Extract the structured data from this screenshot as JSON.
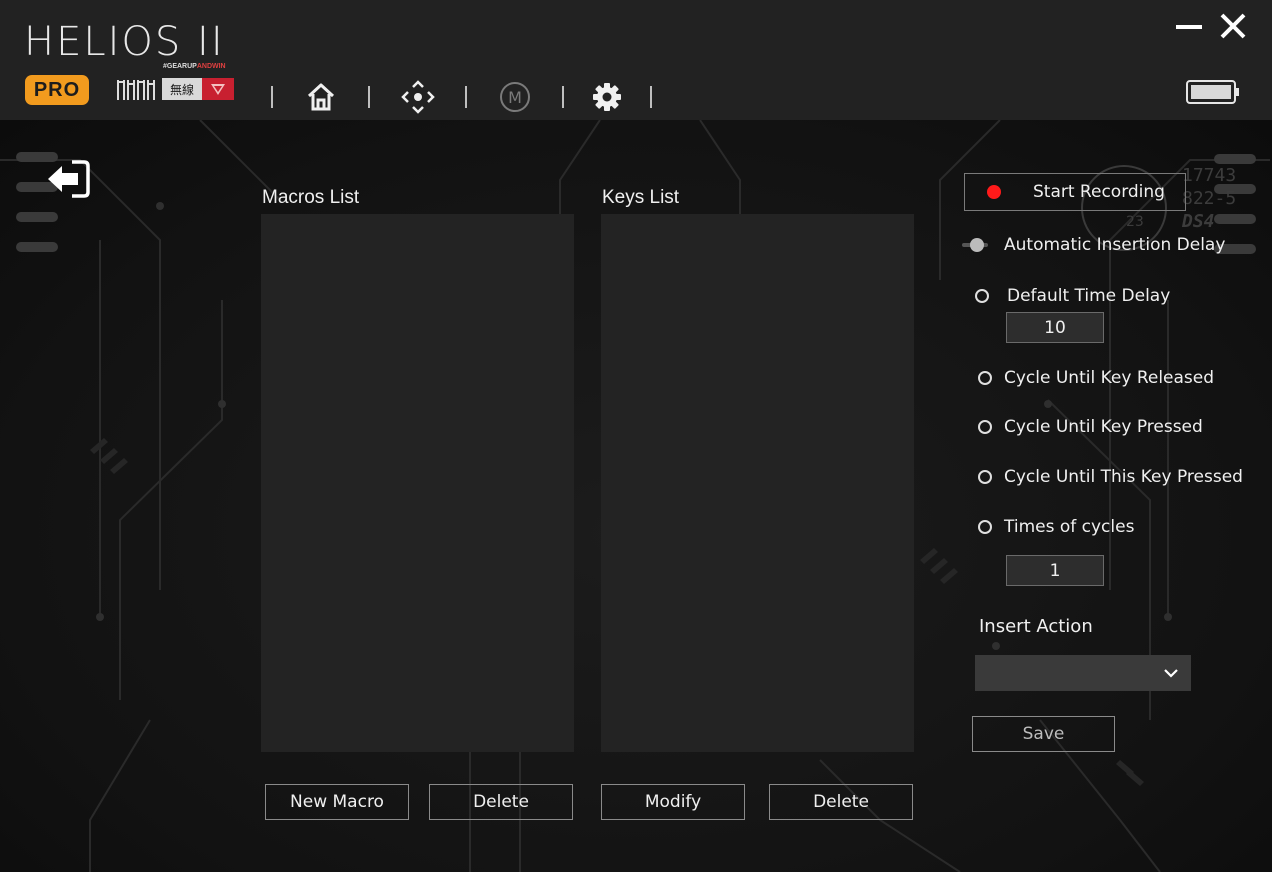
{
  "header": {
    "logo_title": "HELIOS II",
    "logo_tag_prefix": "#GEARUP",
    "logo_tag_suffix": "ANDWIN",
    "pro_badge": "PRO",
    "wireless_badge": "無線",
    "nav_icons": [
      "home-icon",
      "move-icon",
      "macro-icon",
      "gear-icon"
    ],
    "window_controls": [
      "minimize-icon",
      "close-icon"
    ],
    "battery": "battery-icon"
  },
  "macros": {
    "title": "Macros List",
    "items": [],
    "new_label": "New Macro",
    "delete_label": "Delete"
  },
  "keys": {
    "title": "Keys List",
    "items": [],
    "modify_label": "Modify",
    "delete_label": "Delete"
  },
  "recording": {
    "start_label": "Start Recording",
    "auto_delay_label": "Automatic Insertion Delay",
    "default_delay_label": "Default Time Delay",
    "default_delay_value": "10",
    "cycle_released_label": "Cycle Until Key Released",
    "cycle_pressed_label": "Cycle Until Key Pressed",
    "cycle_this_pressed_label": "Cycle Until This Key Pressed",
    "times_label": "Times of cycles",
    "times_value": "1",
    "insert_action_label": "Insert Action",
    "insert_action_value": "",
    "save_label": "Save"
  },
  "decor": {
    "line1": "17743",
    "line2": "822-5",
    "line3": "DS4",
    "gauge": "23"
  },
  "colors": {
    "header_bg": "#222222",
    "pro_orange": "#f29b1e",
    "record_red": "#ff1a1a",
    "panel": "#232323"
  }
}
